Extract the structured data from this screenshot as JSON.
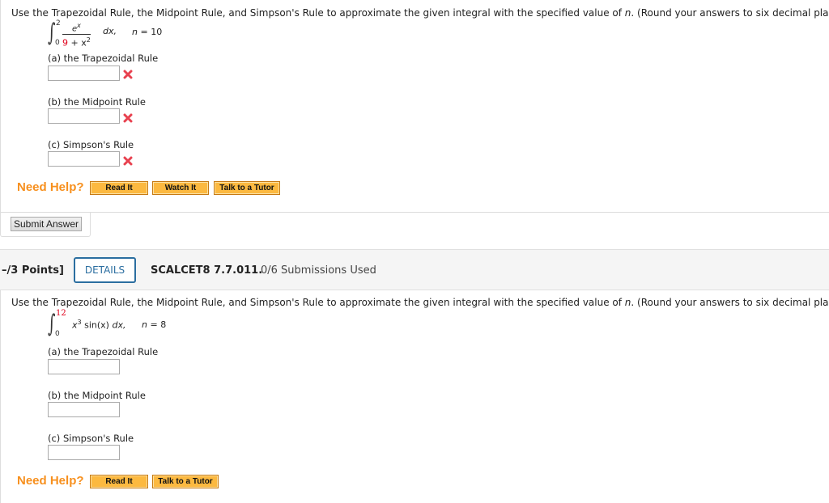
{
  "question1": {
    "prompt_pre": "Use the Trapezoidal Rule, the Midpoint Rule, and Simpson's Rule to approximate the given integral with the specified value of ",
    "prompt_var": "n",
    "prompt_post": ". (Round your answers to six decimal places.)",
    "integral": {
      "lower": "0",
      "upper": "2",
      "numerator": "e",
      "numerator_exp": "x",
      "denominator_red": "9",
      "denominator_rest": " + x",
      "denominator_exp": "2",
      "differential": "dx,",
      "n_label": "n",
      "n_value": "= 10"
    },
    "parts": [
      {
        "label": "(a) the Trapezoidal Rule",
        "value": "",
        "status": "incorrect"
      },
      {
        "label": "(b) the Midpoint Rule",
        "value": "",
        "status": "incorrect"
      },
      {
        "label": "(c) Simpson's Rule",
        "value": "",
        "status": "incorrect"
      }
    ],
    "help": {
      "label": "Need Help?",
      "buttons": [
        "Read It",
        "Watch It",
        "Talk to a Tutor"
      ]
    },
    "submit_label": "Submit Answer"
  },
  "question2": {
    "points": "–/3 Points]",
    "details_label": "DETAILS",
    "question_id": "SCALCET8 7.7.011.",
    "submissions": "0/6 Submissions Used",
    "prompt_pre": "Use the Trapezoidal Rule, the Midpoint Rule, and Simpson's Rule to approximate the given integral with the specified value of ",
    "prompt_var": "n",
    "prompt_post": ". (Round your answers to six decimal places.)",
    "integral": {
      "lower": "0",
      "upper": "12",
      "integrand_base": "x",
      "integrand_exp": "3",
      "integrand_rest": " sin(x) ",
      "differential": "dx,",
      "n_label": "n",
      "n_value": "= 8"
    },
    "parts": [
      {
        "label": "(a) the Trapezoidal Rule",
        "value": ""
      },
      {
        "label": "(b) the Midpoint Rule",
        "value": ""
      },
      {
        "label": "(c) Simpson's Rule",
        "value": ""
      }
    ],
    "help": {
      "label": "Need Help?",
      "buttons": [
        "Read It",
        "Talk to a Tutor"
      ]
    }
  },
  "colors": {
    "help_orange": "#f7901e",
    "button_orange": "#fcb940",
    "incorrect_red": "#e8414f",
    "details_blue": "#2b6ea0",
    "limit_red": "#e0001b"
  },
  "icons": {
    "incorrect": "x-mark-icon"
  }
}
